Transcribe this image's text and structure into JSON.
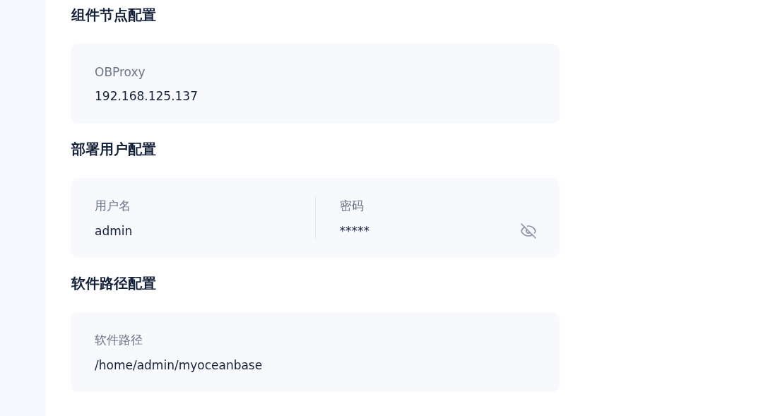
{
  "sections": [
    {
      "title": "组件节点配置",
      "fields": [
        {
          "label": "OBProxy",
          "value": "192.168.125.137"
        }
      ]
    },
    {
      "title": "部署用户配置",
      "fields": [
        {
          "label": "用户名",
          "value": "admin"
        },
        {
          "label": "密码",
          "value": "*****",
          "kind": "password"
        }
      ]
    },
    {
      "title": "软件路径配置",
      "fields": [
        {
          "label": "软件路径",
          "value": "/home/admin/myoceanbase"
        }
      ]
    }
  ]
}
